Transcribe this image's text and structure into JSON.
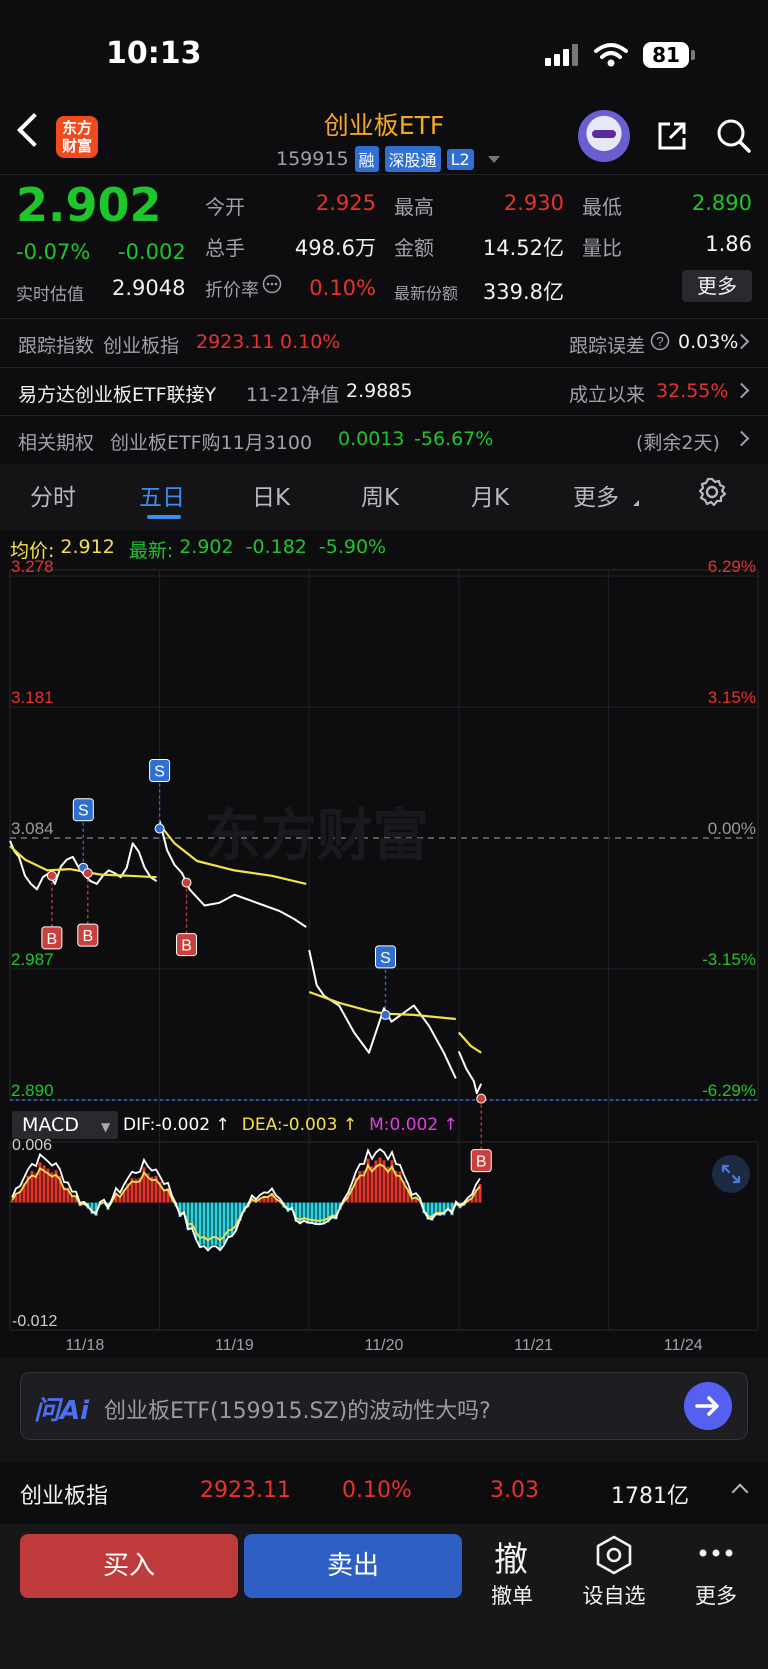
{
  "status": {
    "time": "10:13",
    "battery": "81"
  },
  "header": {
    "logo_line1": "东方",
    "logo_line2": "财富",
    "title": "创业板ETF",
    "code": "159915",
    "tags": [
      "融",
      "深股通",
      "L2"
    ]
  },
  "quote": {
    "price": "2.902",
    "pct": "-0.07%",
    "change": "-0.002",
    "est_label": "实时估值",
    "est_value": "2.9048",
    "open_label": "今开",
    "open": "2.925",
    "high_label": "最高",
    "high": "2.930",
    "low_label": "最低",
    "low": "2.890",
    "vol_label": "总手",
    "vol": "498.6万",
    "amount_label": "金额",
    "amount": "14.52亿",
    "ratio_label": "量比",
    "ratio": "1.86",
    "discount_label": "折价率",
    "discount": "0.10%",
    "shares_label": "最新份额",
    "shares": "339.8亿",
    "more": "更多"
  },
  "track": {
    "label": "跟踪指数",
    "index": "创业板指",
    "value": "2923.11",
    "pct": "0.10%",
    "error_label": "跟踪误差",
    "error": "0.03%"
  },
  "link_fund": {
    "name": "易方达创业板ETF联接Y",
    "date": "11-21净值",
    "nav": "2.9885",
    "since_label": "成立以来",
    "since": "32.55%"
  },
  "option": {
    "label": "相关期权",
    "name": "创业板ETF购11月3100",
    "price": "0.0013",
    "pct": "-56.67%",
    "remain": "(剩余2天)"
  },
  "tabs": [
    "分时",
    "五日",
    "日K",
    "周K",
    "月K",
    "更多"
  ],
  "active_tab": "五日",
  "chart_info": {
    "avg_label": "均价:",
    "avg": "2.912",
    "latest_label": "最新:",
    "latest": "2.902",
    "change": "-0.182",
    "pct": "-5.90%",
    "watermark": "东方财富"
  },
  "macd": {
    "label": "MACD",
    "dif": "DIF:-0.002 ↑",
    "dea": "DEA:-0.003 ↑",
    "m": "M:0.002 ↑"
  },
  "chart_data": {
    "type": "line",
    "price_axis_left": [
      "3.278",
      "3.181",
      "3.084",
      "2.987",
      "2.890"
    ],
    "price_axis_right": [
      "6.29%",
      "3.15%",
      "0.00%",
      "-3.15%",
      "-6.29%"
    ],
    "ylim": [
      2.89,
      3.278
    ],
    "x_labels": [
      "11/18",
      "11/19",
      "11/20",
      "11/21",
      "11/24"
    ],
    "macd_ylim": [
      -0.012,
      0.006
    ],
    "macd_ticks": [
      "0.006",
      "-0.012"
    ],
    "series": [
      {
        "name": "最新",
        "color": "#ffffff",
        "segments": [
          [
            [
              0.0,
              3.082
            ],
            [
              0.03,
              3.074
            ],
            [
              0.06,
              3.07
            ],
            [
              0.1,
              3.056
            ],
            [
              0.14,
              3.05
            ],
            [
              0.18,
              3.046
            ],
            [
              0.22,
              3.055
            ],
            [
              0.26,
              3.058
            ],
            [
              0.3,
              3.05
            ],
            [
              0.34,
              3.063
            ],
            [
              0.38,
              3.068
            ],
            [
              0.42,
              3.07
            ],
            [
              0.46,
              3.062
            ],
            [
              0.5,
              3.056
            ],
            [
              0.54,
              3.052
            ],
            [
              0.58,
              3.05
            ],
            [
              0.62,
              3.056
            ],
            [
              0.66,
              3.06
            ],
            [
              0.7,
              3.058
            ],
            [
              0.74,
              3.055
            ],
            [
              0.78,
              3.062
            ],
            [
              0.82,
              3.08
            ],
            [
              0.86,
              3.074
            ],
            [
              0.9,
              3.062
            ],
            [
              0.94,
              3.055
            ],
            [
              0.98,
              3.052
            ]
          ],
          [
            [
              1.0,
              3.097
            ],
            [
              1.05,
              3.075
            ],
            [
              1.1,
              3.064
            ],
            [
              1.15,
              3.058
            ],
            [
              1.2,
              3.046
            ],
            [
              1.3,
              3.034
            ],
            [
              1.4,
              3.036
            ],
            [
              1.5,
              3.042
            ],
            [
              1.6,
              3.038
            ],
            [
              1.7,
              3.034
            ],
            [
              1.8,
              3.03
            ],
            [
              1.9,
              3.024
            ],
            [
              1.98,
              3.018
            ]
          ],
          [
            [
              2.0,
              3.001
            ],
            [
              2.05,
              2.975
            ],
            [
              2.1,
              2.967
            ],
            [
              2.2,
              2.96
            ],
            [
              2.3,
              2.94
            ],
            [
              2.4,
              2.925
            ],
            [
              2.5,
              2.958
            ],
            [
              2.55,
              2.948
            ],
            [
              2.6,
              2.952
            ],
            [
              2.7,
              2.96
            ],
            [
              2.8,
              2.945
            ],
            [
              2.9,
              2.925
            ],
            [
              2.98,
              2.906
            ]
          ],
          [
            [
              3.0,
              2.926
            ],
            [
              3.05,
              2.913
            ],
            [
              3.1,
              2.904
            ],
            [
              3.12,
              2.895
            ],
            [
              3.15,
              2.902
            ]
          ]
        ]
      },
      {
        "name": "均价",
        "color": "#f4e04d",
        "segments": [
          [
            [
              0.0,
              3.078
            ],
            [
              0.1,
              3.068
            ],
            [
              0.25,
              3.06
            ],
            [
              0.4,
              3.061
            ],
            [
              0.6,
              3.057
            ],
            [
              0.8,
              3.056
            ],
            [
              0.98,
              3.055
            ]
          ],
          [
            [
              1.0,
              3.094
            ],
            [
              1.1,
              3.08
            ],
            [
              1.25,
              3.067
            ],
            [
              1.5,
              3.06
            ],
            [
              1.75,
              3.056
            ],
            [
              1.98,
              3.05
            ]
          ],
          [
            [
              2.0,
              2.97
            ],
            [
              2.2,
              2.962
            ],
            [
              2.4,
              2.956
            ],
            [
              2.5,
              2.954
            ],
            [
              2.7,
              2.953
            ],
            [
              2.98,
              2.95
            ]
          ],
          [
            [
              3.0,
              2.94
            ],
            [
              3.08,
              2.93
            ],
            [
              3.15,
              2.925
            ]
          ]
        ]
      }
    ],
    "markers": [
      {
        "type": "B",
        "x": 0.28,
        "y": 3.056
      },
      {
        "type": "S",
        "x": 0.49,
        "y": 3.062
      },
      {
        "type": "B",
        "x": 0.52,
        "y": 3.058
      },
      {
        "type": "S",
        "x": 1.0,
        "y": 3.091
      },
      {
        "type": "B",
        "x": 1.18,
        "y": 3.051
      },
      {
        "type": "S",
        "x": 2.51,
        "y": 2.953
      },
      {
        "type": "B",
        "x": 3.15,
        "y": 2.891
      }
    ]
  },
  "ai": {
    "logo": "问Ai",
    "prompt": "创业板ETF(159915.SZ)的波动性大吗?"
  },
  "index_bar": {
    "name": "创业板指",
    "value": "2923.11",
    "pct": "0.10%",
    "change": "3.03",
    "amount": "1781亿"
  },
  "actions": {
    "buy": "买入",
    "sell": "卖出",
    "cancel": "撤单",
    "cancel_glyph": "撤",
    "watchlist": "设自选",
    "more": "更多"
  }
}
